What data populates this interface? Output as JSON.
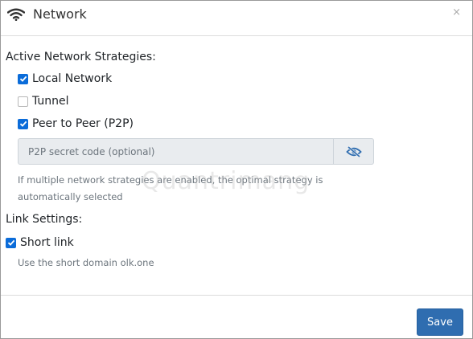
{
  "header": {
    "title": "Network",
    "icon": "wifi-icon",
    "close": "×"
  },
  "strategies": {
    "title": "Active Network Strategies:",
    "items": [
      {
        "label": "Local Network",
        "checked": true
      },
      {
        "label": "Tunnel",
        "checked": false
      },
      {
        "label": "Peer to Peer (P2P)",
        "checked": true
      }
    ],
    "secret": {
      "placeholder": "P2P secret code (optional)",
      "value": ""
    },
    "help_line1": "If multiple network strategies are enabled, the optimal strategy is",
    "help_line2": "automatically selected"
  },
  "link_settings": {
    "title": "Link Settings:",
    "short_link": {
      "label": "Short link",
      "checked": true
    },
    "help": "Use the short domain olk.one"
  },
  "footer": {
    "save_label": "Save"
  },
  "watermark": "Quantrimang",
  "colors": {
    "accent": "#0b6cd9",
    "save": "#2f6db0"
  }
}
